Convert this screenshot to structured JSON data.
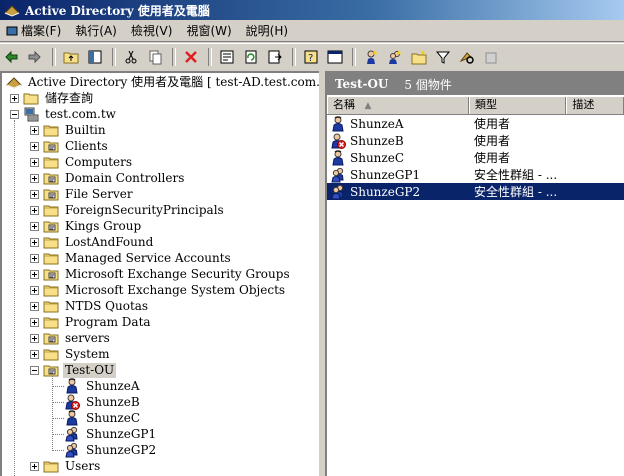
{
  "window": {
    "title": "Active Directory 使用者及電腦"
  },
  "menu": [
    "檔案(F)",
    "執行(A)",
    "檢視(V)",
    "視窗(W)",
    "說明(H)"
  ],
  "toolbar": [
    "back-arrow-icon",
    "forward-arrow-icon",
    "up-folder-icon",
    "show-tree-icon",
    "cut-icon",
    "copy-icon",
    "delete-icon",
    "properties-icon",
    "refresh-icon",
    "export-icon",
    "help-icon",
    "console-icon",
    "new-user-icon",
    "new-group-icon",
    "new-ou-icon",
    "filter-icon",
    "find-icon",
    "add-to-group-icon"
  ],
  "tree": {
    "root": "Active Directory 使用者及電腦 [ test-AD.test.com.tw ]",
    "saved_queries": "儲存查詢",
    "domain": "test.com.tw",
    "containers": [
      {
        "label": "Builtin",
        "type": "folder"
      },
      {
        "label": "Clients",
        "type": "ou"
      },
      {
        "label": "Computers",
        "type": "folder"
      },
      {
        "label": "Domain Controllers",
        "type": "ou"
      },
      {
        "label": "File Server",
        "type": "ou"
      },
      {
        "label": "ForeignSecurityPrincipals",
        "type": "folder"
      },
      {
        "label": "Kings Group",
        "type": "ou"
      },
      {
        "label": "LostAndFound",
        "type": "folder"
      },
      {
        "label": "Managed Service Accounts",
        "type": "folder"
      },
      {
        "label": "Microsoft Exchange Security Groups",
        "type": "ou"
      },
      {
        "label": "Microsoft Exchange System Objects",
        "type": "folder"
      },
      {
        "label": "NTDS Quotas",
        "type": "folder"
      },
      {
        "label": "Program Data",
        "type": "folder"
      },
      {
        "label": "servers",
        "type": "ou"
      },
      {
        "label": "System",
        "type": "folder"
      }
    ],
    "selected_ou": "Test-OU",
    "children": [
      {
        "label": "ShunzeA",
        "type": "user"
      },
      {
        "label": "ShunzeB",
        "type": "user-disabled"
      },
      {
        "label": "ShunzeC",
        "type": "user"
      },
      {
        "label": "ShunzeGP1",
        "type": "group"
      },
      {
        "label": "ShunzeGP2",
        "type": "group"
      }
    ],
    "after": [
      {
        "label": "Users",
        "type": "folder"
      }
    ]
  },
  "right": {
    "header_title": "Test-OU",
    "header_count": "5 個物件",
    "columns": [
      "名稱",
      "類型",
      "描述"
    ],
    "rows": [
      {
        "name": "ShunzeA",
        "type": "使用者",
        "desc": "",
        "icon": "user"
      },
      {
        "name": "ShunzeB",
        "type": "使用者",
        "desc": "",
        "icon": "user-disabled"
      },
      {
        "name": "ShunzeC",
        "type": "使用者",
        "desc": "",
        "icon": "user"
      },
      {
        "name": "ShunzeGP1",
        "type": "安全性群組 - ...",
        "desc": "",
        "icon": "group"
      },
      {
        "name": "ShunzeGP2",
        "type": "安全性群組 - ...",
        "desc": "",
        "icon": "group",
        "selected": true
      }
    ]
  }
}
